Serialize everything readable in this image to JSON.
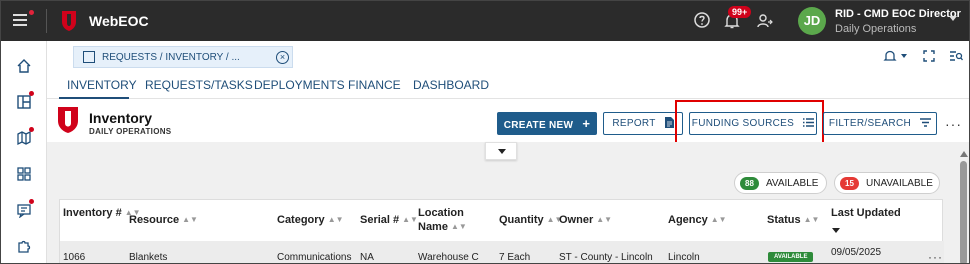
{
  "app": {
    "name": "WebEOC"
  },
  "topbar": {
    "notifications_badge": "99+",
    "user_initials": "JD",
    "user_name": "RID - CMD EOC Director",
    "user_role": "Daily Operations"
  },
  "tab": {
    "label": "REQUESTS / INVENTORY / ..."
  },
  "nav": {
    "tabs": [
      "INVENTORY",
      "REQUESTS/TASKS",
      "DEPLOYMENTS",
      "FINANCE",
      "DASHBOARD"
    ]
  },
  "header": {
    "title": "Inventory",
    "subtitle": "DAILY OPERATIONS",
    "buttons": {
      "create_new": "CREATE NEW",
      "report": "REPORT",
      "funding_sources": "FUNDING SOURCES",
      "filter_search": "FILTER/SEARCH"
    }
  },
  "summary": {
    "available_count": "88",
    "available_label": "AVAILABLE",
    "unavailable_count": "15",
    "unavailable_label": "UNAVAILABLE"
  },
  "table": {
    "columns": {
      "inventory": [
        "Inventory #",
        ""
      ],
      "resource": "Resource",
      "category": "Category",
      "serial": "Serial #",
      "location": [
        "Location",
        "Name"
      ],
      "quantity": "Quantity",
      "owner": "Owner",
      "agency": "Agency",
      "status": "Status",
      "last_updated": "Last Updated"
    },
    "rows": [
      {
        "inventory": "1066",
        "resource": "Blankets",
        "category": "Communications",
        "serial": "NA",
        "location": "Warehouse C",
        "quantity": "7 Each",
        "owner": "ST - County - Lincoln",
        "agency": "Lincoln",
        "status": "AVAILABLE",
        "last_updated": "09/05/2025"
      }
    ]
  },
  "colors": {
    "topbar": "#2b2b2b",
    "primary": "#1f5c8b",
    "accent_red": "#e00000",
    "available_green": "#2e8b3a",
    "unavailable_red": "#e53935"
  }
}
